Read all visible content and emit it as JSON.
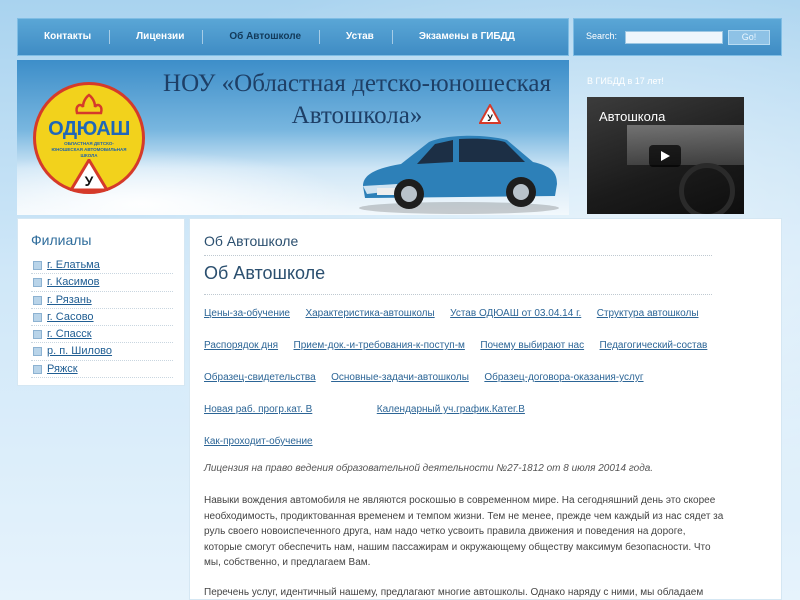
{
  "nav": {
    "items": [
      {
        "label": "Контакты"
      },
      {
        "label": "Лицензии"
      },
      {
        "label": "Об Автошколе",
        "active": true
      },
      {
        "label": "Устав"
      },
      {
        "label": "Экзамены в ГИБДД"
      }
    ]
  },
  "search": {
    "label": "Search:",
    "placeholder": "",
    "button": "Go!"
  },
  "header": {
    "title_line1": "НОУ «Областная детско-юношеская",
    "title_line2": "Автошкола»",
    "logo_text": "ОДЮАШ",
    "logo_subtitle": "ОБЛАСТНАЯ ДЕТСКО-ЮНОШЕСКАЯ АВТОМОБИЛЬНАЯ ШКОЛА",
    "sign_letter": "У",
    "icons": [
      "logo-emblem-icon",
      "learner-sign-icon",
      "car-image-icon"
    ]
  },
  "right_panel": {
    "caption": "В ГИБДД в 17 лет!",
    "video_title": "Автошкола",
    "play_icon": "play-icon"
  },
  "sidebar": {
    "title": "Филиалы",
    "items": [
      {
        "label": "г. Елатьма"
      },
      {
        "label": "г. Касимов"
      },
      {
        "label": "г. Рязань"
      },
      {
        "label": "г. Сасово"
      },
      {
        "label": "г. Спасск"
      },
      {
        "label": "р. п. Шилово"
      },
      {
        "label": "Ряжск"
      }
    ]
  },
  "main": {
    "breadcrumb": "Об Автошколе",
    "title": "Об Автошколе",
    "link_rows": [
      [
        "Цены-за-обучение",
        "Характеристика-автошколы",
        "Устав ОДЮАШ от 03.04.14 г.",
        "Структура автошколы"
      ],
      [
        "Распорядок дня",
        "Прием-док.-и-требования-к-поступ-м",
        "Почему выбирают нас",
        "Педагогический-состав"
      ],
      [
        "Образец-свидетельства",
        "Основные-задачи-автошколы",
        "Образец-договора-оказания-услуг"
      ],
      [
        "Новая раб. прогр.кат. В",
        "Календарный уч.график.Катег.В"
      ],
      [
        "Как-проходит-обучение"
      ]
    ],
    "license": "Лицензия на право ведения образовательной деятельности №27-1812 от 8 июля 20014 года.",
    "paragraph1": "Навыки вождения автомобиля не являются роскошью в современном мире. На сегодняшний день это скорее необходимость, продиктованная временем и темпом жизни. Тем не менее, прежде чем каждый из нас сядет за руль своего новоиспеченного друга, нам надо четко усвоить правила движения и поведения на дороге, которые смогут обеспечить нам, нашим пассажирам и окружающему обществу максимум безопасности. Что мы, собственно, и предлагаем Вам.",
    "paragraph2": "Перечень услуг, идентичный нашему, предлагают многие автошколы. Однако наряду с ними, мы обладаем"
  },
  "colors": {
    "nav_bg": "#4a9acd",
    "link": "#2c6596",
    "heading": "#2b4f6f",
    "logo_yellow": "#f2d21c",
    "logo_red": "#d53a2a"
  }
}
